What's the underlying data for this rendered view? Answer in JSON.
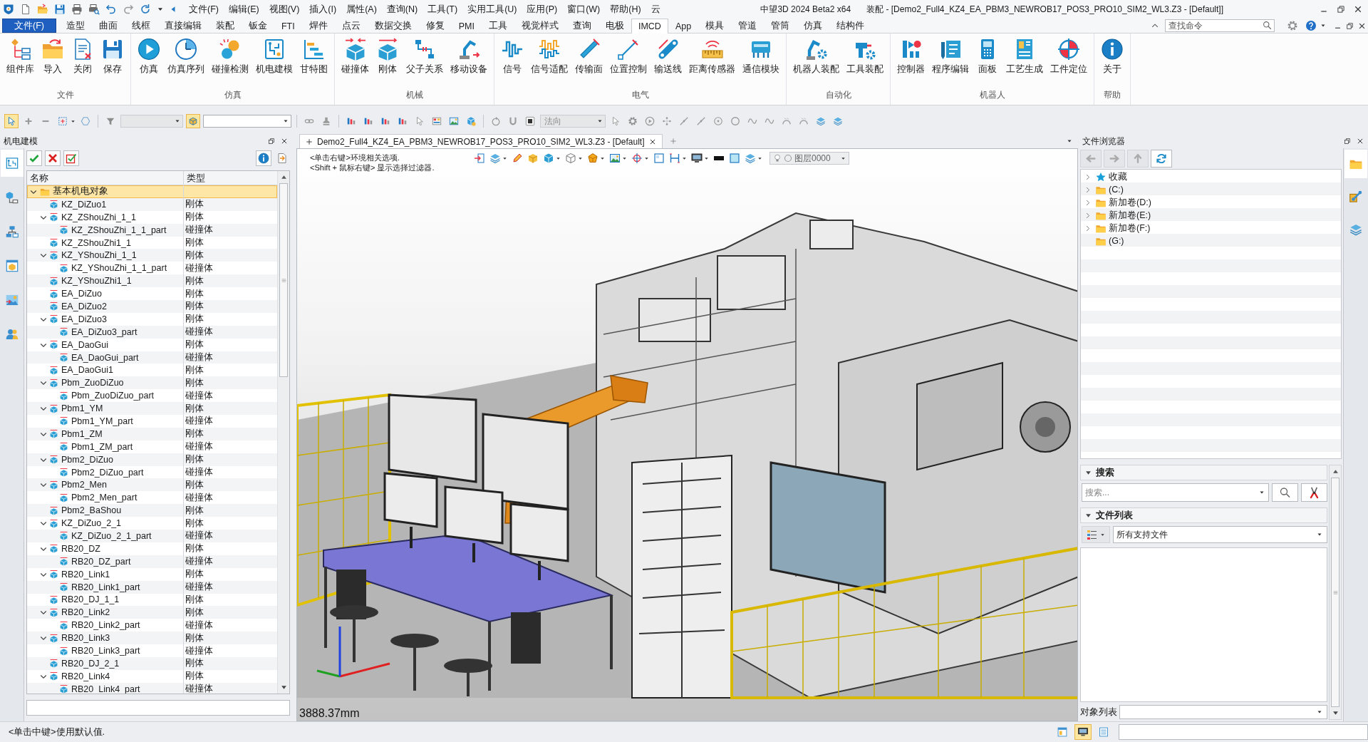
{
  "title_bar": {
    "menus": [
      "文件(F)",
      "编辑(E)",
      "视图(V)",
      "插入(I)",
      "属性(A)",
      "查询(N)",
      "工具(T)",
      "实用工具(U)",
      "应用(P)",
      "窗口(W)",
      "帮助(H)",
      "云"
    ],
    "app_title": "中望3D 2024 Beta2 x64",
    "document_title": "装配 - [Demo2_Full4_KZ4_EA_PBM3_NEWROB17_POS3_PRO10_SIM2_WL3.Z3 - [Default]]"
  },
  "ribbon": {
    "file_button": "文件(F)",
    "tabs": [
      {
        "label": "造型",
        "selected": false
      },
      {
        "label": "曲面",
        "selected": false
      },
      {
        "label": "线框",
        "selected": false
      },
      {
        "label": "直接编辑",
        "selected": false
      },
      {
        "label": "装配",
        "selected": false
      },
      {
        "label": "钣金",
        "selected": false
      },
      {
        "label": "FTI",
        "selected": false
      },
      {
        "label": "焊件",
        "selected": false
      },
      {
        "label": "点云",
        "selected": false
      },
      {
        "label": "数据交换",
        "selected": false
      },
      {
        "label": "修复",
        "selected": false
      },
      {
        "label": "PMI",
        "selected": false
      },
      {
        "label": "工具",
        "selected": false
      },
      {
        "label": "视觉样式",
        "selected": false
      },
      {
        "label": "查询",
        "selected": false
      },
      {
        "label": "电极",
        "selected": false
      },
      {
        "label": "IMCD",
        "selected": true
      },
      {
        "label": "App",
        "selected": false
      },
      {
        "label": "模具",
        "selected": false
      },
      {
        "label": "管道",
        "selected": false
      },
      {
        "label": "管筒",
        "selected": false
      },
      {
        "label": "仿真",
        "selected": false
      },
      {
        "label": "结构件",
        "selected": false
      }
    ],
    "command_search": {
      "placeholder": "查找命令"
    },
    "groups": [
      {
        "label": "文件",
        "buttons": [
          "组件库",
          "导入",
          "关闭",
          "保存"
        ]
      },
      {
        "label": "仿真",
        "buttons": [
          "仿真",
          "仿真序列",
          "碰撞检测",
          "机电建模",
          "甘特图"
        ]
      },
      {
        "label": "机械",
        "buttons": [
          "碰撞体",
          "刚体",
          "父子关系",
          "移动设备"
        ]
      },
      {
        "label": "电气",
        "buttons": [
          "信号",
          "信号适配",
          "传输面",
          "位置控制",
          "输送线",
          "距离传感器",
          "通信模块"
        ]
      },
      {
        "label": "自动化",
        "buttons": [
          "机器人装配",
          "工具装配"
        ]
      },
      {
        "label": "机器人",
        "buttons": [
          "控制器",
          "程序编辑",
          "面板",
          "工艺生成",
          "工件定位"
        ]
      },
      {
        "label": "帮助",
        "buttons": [
          "关于"
        ]
      }
    ]
  },
  "toolbar": {
    "pick_tool": {
      "on": true
    },
    "type_combo": {
      "disabled": true
    },
    "filter_toggle": {
      "on": true
    },
    "direction_combo": {
      "value": "法向",
      "disabled": true
    }
  },
  "left_panel": {
    "title": "机电建模",
    "side_tabs": [
      {
        "selected": true
      },
      {
        "selected": false
      },
      {
        "selected": false
      },
      {
        "selected": false
      },
      {
        "selected": false
      },
      {
        "selected": false
      }
    ],
    "columns": [
      "名称",
      "类型"
    ],
    "tree": {
      "label": "基本机电对象",
      "selected": true,
      "expanded": true,
      "children": [
        {
          "label": "KZ_DiZuo1",
          "type": "刚体",
          "selected": false
        },
        {
          "label": "KZ_ZShouZhi_1_1",
          "type": "刚体",
          "selected": false,
          "expanded": true,
          "children": [
            {
              "label": "KZ_ZShouZhi_1_1_part",
              "type": "碰撞体",
              "selected": false
            }
          ]
        },
        {
          "label": "KZ_ZShouZhi1_1",
          "type": "刚体",
          "selected": false
        },
        {
          "label": "KZ_YShouZhi_1_1",
          "type": "刚体",
          "selected": false,
          "expanded": true,
          "children": [
            {
              "label": "KZ_YShouZhi_1_1_part",
              "type": "碰撞体",
              "selected": false
            }
          ]
        },
        {
          "label": "KZ_YShouZhi1_1",
          "type": "刚体",
          "selected": false
        },
        {
          "label": "EA_DiZuo",
          "type": "刚体",
          "selected": false
        },
        {
          "label": "EA_DiZuo2",
          "type": "刚体",
          "selected": false
        },
        {
          "label": "EA_DiZuo3",
          "type": "刚体",
          "selected": false,
          "expanded": true,
          "children": [
            {
              "label": "EA_DiZuo3_part",
              "type": "碰撞体",
              "selected": false
            }
          ]
        },
        {
          "label": "EA_DaoGui",
          "type": "刚体",
          "selected": false,
          "expanded": true,
          "children": [
            {
              "label": "EA_DaoGui_part",
              "type": "碰撞体",
              "selected": false
            }
          ]
        },
        {
          "label": "EA_DaoGui1",
          "type": "刚体",
          "selected": false
        },
        {
          "label": "Pbm_ZuoDiZuo",
          "type": "刚体",
          "selected": false,
          "expanded": true,
          "children": [
            {
              "label": "Pbm_ZuoDiZuo_part",
              "type": "碰撞体",
              "selected": false
            }
          ]
        },
        {
          "label": "Pbm1_YM",
          "type": "刚体",
          "selected": false,
          "expanded": true,
          "children": [
            {
              "label": "Pbm1_YM_part",
              "type": "碰撞体",
              "selected": false
            }
          ]
        },
        {
          "label": "Pbm1_ZM",
          "type": "刚体",
          "selected": false,
          "expanded": true,
          "children": [
            {
              "label": "Pbm1_ZM_part",
              "type": "碰撞体",
              "selected": false
            }
          ]
        },
        {
          "label": "Pbm2_DiZuo",
          "type": "刚体",
          "selected": false,
          "expanded": true,
          "children": [
            {
              "label": "Pbm2_DiZuo_part",
              "type": "碰撞体",
              "selected": false
            }
          ]
        },
        {
          "label": "Pbm2_Men",
          "type": "刚体",
          "selected": false,
          "expanded": true,
          "children": [
            {
              "label": "Pbm2_Men_part",
              "type": "碰撞体",
              "selected": false
            }
          ]
        },
        {
          "label": "Pbm2_BaShou",
          "type": "刚体",
          "selected": false
        },
        {
          "label": "KZ_DiZuo_2_1",
          "type": "刚体",
          "selected": false,
          "expanded": true,
          "children": [
            {
              "label": "KZ_DiZuo_2_1_part",
              "type": "碰撞体",
              "selected": false
            }
          ]
        },
        {
          "label": "RB20_DZ",
          "type": "刚体",
          "selected": false,
          "expanded": true,
          "children": [
            {
              "label": "RB20_DZ_part",
              "type": "碰撞体",
              "selected": false
            }
          ]
        },
        {
          "label": "RB20_Link1",
          "type": "刚体",
          "selected": false,
          "expanded": true,
          "children": [
            {
              "label": "RB20_Link1_part",
              "type": "碰撞体",
              "selected": false
            }
          ]
        },
        {
          "label": "RB20_DJ_1_1",
          "type": "刚体",
          "selected": false
        },
        {
          "label": "RB20_Link2",
          "type": "刚体",
          "selected": false,
          "expanded": true,
          "children": [
            {
              "label": "RB20_Link2_part",
              "type": "碰撞体",
              "selected": false
            }
          ]
        },
        {
          "label": "RB20_Link3",
          "type": "刚体",
          "selected": false,
          "expanded": true,
          "children": [
            {
              "label": "RB20_Link3_part",
              "type": "碰撞体",
              "selected": false
            }
          ]
        },
        {
          "label": "RB20_DJ_2_1",
          "type": "刚体",
          "selected": false
        },
        {
          "label": "RB20_Link4",
          "type": "刚体",
          "selected": false,
          "expanded": true,
          "children": [
            {
              "label": "RB20_Link4_part",
              "type": "碰撞体",
              "selected": false
            }
          ]
        }
      ]
    }
  },
  "viewport": {
    "document_tab": "Demo2_Full4_KZ4_EA_PBM3_NEWROB17_POS3_PRO10_SIM2_WL3.Z3 - [Default]",
    "hints": [
      "<单击右键>环境相关选项.",
      "<Shift + 鼠标右键> 显示选择过滤器."
    ],
    "layer_combo": "图层0000",
    "scale_readout": "3888.37mm"
  },
  "right_panel": {
    "title": "文件浏览器",
    "side_tabs": [
      {
        "selected": true
      },
      {
        "selected": false
      },
      {
        "selected": false
      }
    ],
    "locations": [
      {
        "label": "收藏",
        "kind": "favorites",
        "expanded": false,
        "selected": false
      },
      {
        "label": "(C:)",
        "kind": "drive",
        "expanded": false,
        "selected": false
      },
      {
        "label": "新加卷(D:)",
        "kind": "drive",
        "expanded": false,
        "selected": false
      },
      {
        "label": "新加卷(E:)",
        "kind": "drive",
        "expanded": false,
        "selected": false
      },
      {
        "label": "新加卷(F:)",
        "kind": "drive",
        "expanded": false,
        "selected": false
      },
      {
        "label": "(G:)",
        "kind": "drive",
        "selected": false
      }
    ],
    "search_section": {
      "title": "搜索",
      "expanded": true,
      "search_field": {
        "placeholder": "搜索..."
      }
    },
    "file_list_section": {
      "title": "文件列表",
      "expanded": true,
      "filter": "所有支持文件"
    },
    "object_list": {
      "label": "对象列表"
    }
  },
  "status_bar": {
    "prompt": "<单击中键>使用默认值.",
    "view_toggles": [
      {
        "selected": false
      },
      {
        "selected": true
      },
      {
        "selected": false
      }
    ]
  }
}
